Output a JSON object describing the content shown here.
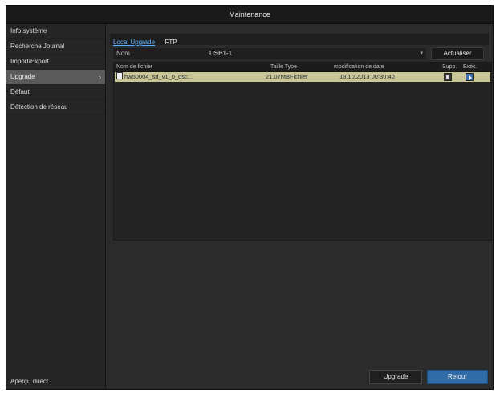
{
  "window": {
    "title": "Maintenance"
  },
  "sidebar": {
    "items": [
      {
        "label": "Info système"
      },
      {
        "label": "Recherche Journal"
      },
      {
        "label": "Import/Export"
      },
      {
        "label": "Upgrade"
      },
      {
        "label": "Défaut"
      },
      {
        "label": "Détection de réseau"
      }
    ],
    "active": "Upgrade",
    "bottom_label": "Aperçu direct"
  },
  "tabs": [
    {
      "label": "Local Upgrade"
    },
    {
      "label": "FTP"
    }
  ],
  "device": {
    "label": "Nom",
    "value": "USB1-1"
  },
  "refresh_label": "Actualiser",
  "table": {
    "columns": [
      "Nom de fichier",
      "Taille Type",
      "modification de date",
      "Supp.",
      "Exéc."
    ],
    "rows": [
      {
        "name": "hw50004_sd_v1_0_dsc...",
        "size_type": "21.07MBFichier",
        "modified": "18.10.2013 00:30:40"
      }
    ]
  },
  "buttons": {
    "upgrade": "Upgrade",
    "back": "Retour"
  },
  "colors": {
    "accent": "#2f6ca8",
    "selected_row": "#c9c79a",
    "tab_active": "#5bb1ff"
  }
}
